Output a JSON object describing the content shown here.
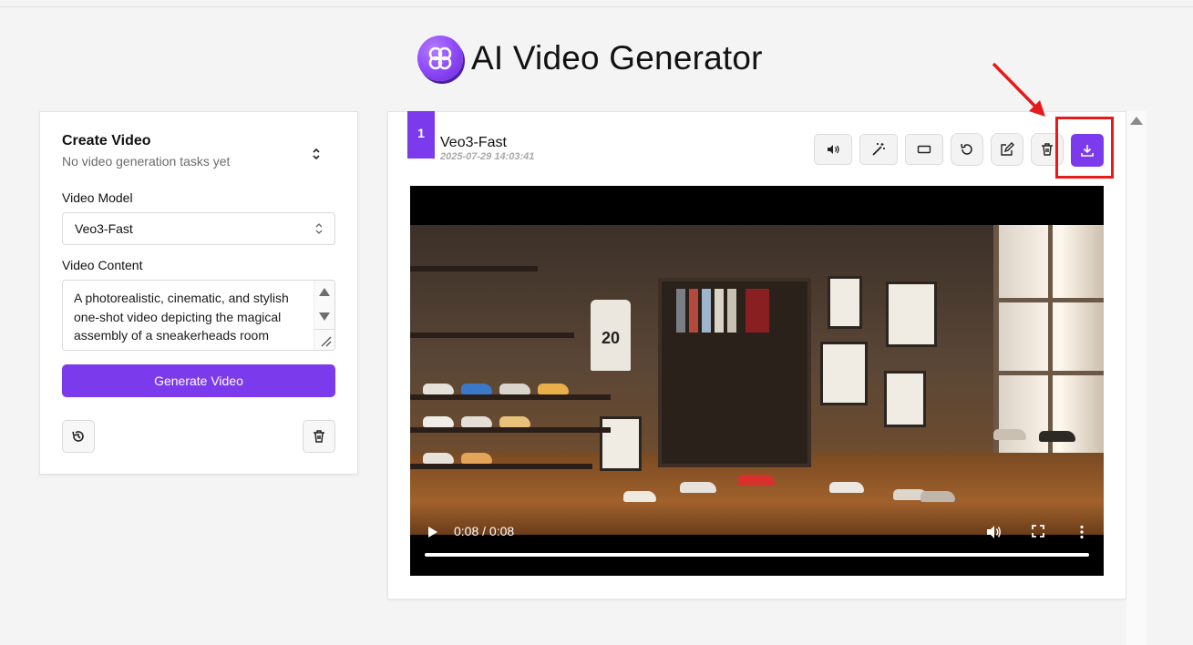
{
  "app": {
    "title": "AI Video Generator",
    "logo": "clover-logo-icon",
    "accent": "#7c3aed"
  },
  "left_panel": {
    "title": "Create Video",
    "status": "No video generation tasks yet",
    "video_model_label": "Video Model",
    "video_model_value": "Veo3-Fast",
    "video_content_label": "Video Content",
    "video_content_value": "A photorealistic, cinematic, and stylish one-shot video depicting the magical assembly of a sneakerheads room",
    "generate_label": "Generate Video",
    "history_icon": "history-icon",
    "trash_icon": "trash-icon"
  },
  "task": {
    "index": "1",
    "model": "Veo3-Fast",
    "timestamp": "2025-07-29 14:03:41",
    "toolbar": [
      "volume-icon",
      "magic-wand-icon",
      "aspect-ratio-icon",
      "regenerate-icon",
      "edit-icon",
      "trash-icon",
      "download-icon"
    ],
    "video": {
      "time": "0:08 / 0:08",
      "progress": 1.0,
      "jersey_number": "20"
    }
  },
  "annotation": {
    "color": "#e51b1b",
    "target": "download-button"
  }
}
